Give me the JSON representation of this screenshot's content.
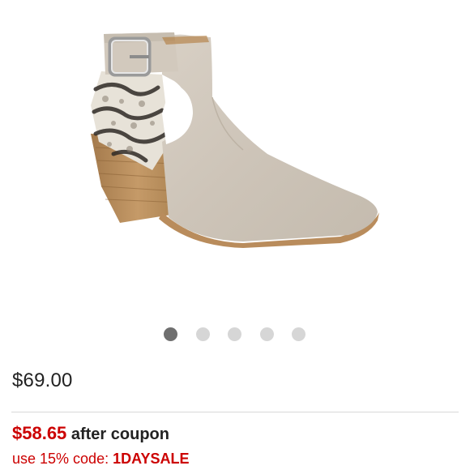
{
  "product": {
    "image_alt": "Taupe suede cut-out ankle bootie with snakeskin heel panel and buckle strap"
  },
  "carousel": {
    "total": 5,
    "active_index": 0
  },
  "pricing": {
    "regular_price": "$69.00",
    "coupon_price": "$58.65",
    "coupon_suffix": "after coupon",
    "code_prefix": "use 15% code: ",
    "code": "1DAYSALE"
  },
  "colors": {
    "sale_red": "#cc0000",
    "text_dark": "#222222",
    "dot_active": "#6f6f6f",
    "dot_inactive": "#d6d6d6"
  }
}
